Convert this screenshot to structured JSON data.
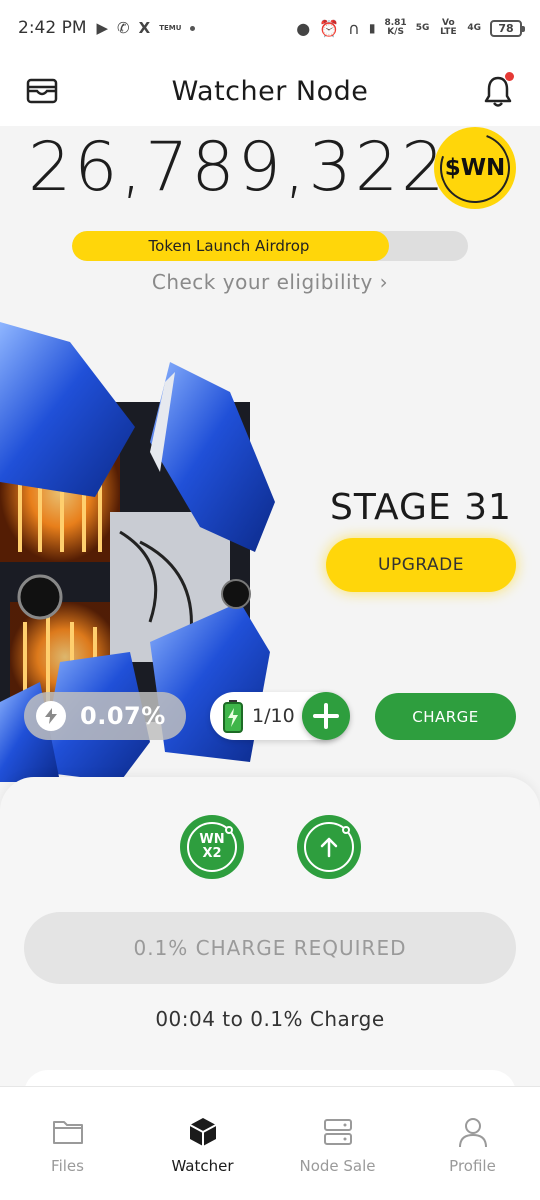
{
  "status_bar": {
    "time": "2:42 PM",
    "temu_label": "TEMU",
    "net_speed": "8.81",
    "net_unit": "K/S",
    "signal_5g": "5G",
    "volte": "Vo LTE",
    "signal_4g": "4G",
    "battery": "78"
  },
  "header": {
    "title": "Watcher Node"
  },
  "balance": {
    "amount": "26,789,322",
    "token": "$WN"
  },
  "airdrop": {
    "label": "Token Launch Airdrop",
    "progress": 0.8,
    "eligibility_link": "Check your eligibility ›"
  },
  "node": {
    "stage": "STAGE 31",
    "upgrade_label": "UPGRADE"
  },
  "stats": {
    "speed": "0.07%",
    "batteries": "1/10",
    "charge_label": "CHARGE"
  },
  "boosts": {
    "multiplier_line1": "WN",
    "multiplier_line2": "X2"
  },
  "action": {
    "charge_required": "0.1% CHARGE REQUIRED",
    "timer_text": "00:04 to 0.1% Charge"
  },
  "nav": {
    "items": [
      {
        "label": "Files",
        "icon": "folder-icon"
      },
      {
        "label": "Watcher",
        "icon": "cube-icon"
      },
      {
        "label": "Node Sale",
        "icon": "server-icon"
      },
      {
        "label": "Profile",
        "icon": "user-icon"
      }
    ],
    "active": "Watcher"
  },
  "colors": {
    "accent_yellow": "#ffd60a",
    "accent_green": "#2e9e3e",
    "notification_red": "#e53935"
  }
}
